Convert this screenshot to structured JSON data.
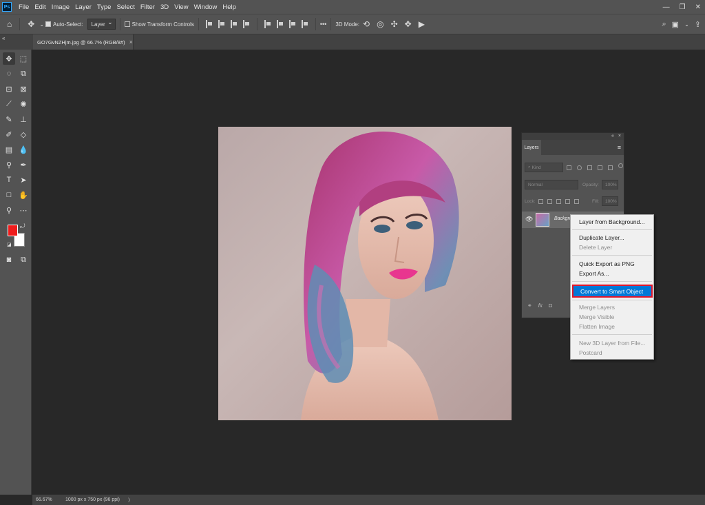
{
  "app": {
    "logo": "Ps"
  },
  "menu": [
    "File",
    "Edit",
    "Image",
    "Layer",
    "Type",
    "Select",
    "Filter",
    "3D",
    "View",
    "Window",
    "Help"
  ],
  "window_controls": {
    "minimize": "—",
    "restore": "❐",
    "close": "✕"
  },
  "options": {
    "auto_select_label": "Auto-Select:",
    "auto_select_target": "Layer",
    "show_transform_label": "Show Transform Controls",
    "more": "•••",
    "mode_3d_label": "3D Mode:"
  },
  "document": {
    "tab_title": "GO7GvNZHjm.jpg @ 66.7% (RGB/8#)",
    "tab_close": "×"
  },
  "colors": {
    "foreground": "#ee1c1c",
    "background": "#ffffff",
    "accent": "#0078d7",
    "highlight_border": "#e0162a"
  },
  "layers_panel": {
    "tab_label": "Layers",
    "filter_placeholder": "Kind",
    "blend_mode": "Normal",
    "opacity_label": "Opacity:",
    "opacity_value": "100%",
    "lock_label": "Lock:",
    "fill_label": "Fill:",
    "fill_value": "100%",
    "layer_name": "Backgro",
    "bottom_icons": [
      "link-icon",
      "fx-icon",
      "mask-icon"
    ]
  },
  "context_menu": {
    "items": [
      {
        "label": "Layer from Background...",
        "enabled": true
      },
      {
        "label": "Duplicate Layer...",
        "enabled": true
      },
      {
        "label": "Delete Layer",
        "enabled": false
      },
      {
        "label": "Quick Export as PNG",
        "enabled": true
      },
      {
        "label": "Export As...",
        "enabled": true
      },
      {
        "label": "Convert to Smart Object",
        "enabled": true,
        "highlighted": true
      },
      {
        "label": "Merge Layers",
        "enabled": false
      },
      {
        "label": "Merge Visible",
        "enabled": false
      },
      {
        "label": "Flatten Image",
        "enabled": false
      },
      {
        "label": "New 3D Layer from File...",
        "enabled": false
      },
      {
        "label": "Postcard",
        "enabled": false
      }
    ]
  },
  "status": {
    "zoom": "66.67%",
    "doc_info": "1000 px x 750 px (96 ppi)",
    "arrow": "〉"
  }
}
